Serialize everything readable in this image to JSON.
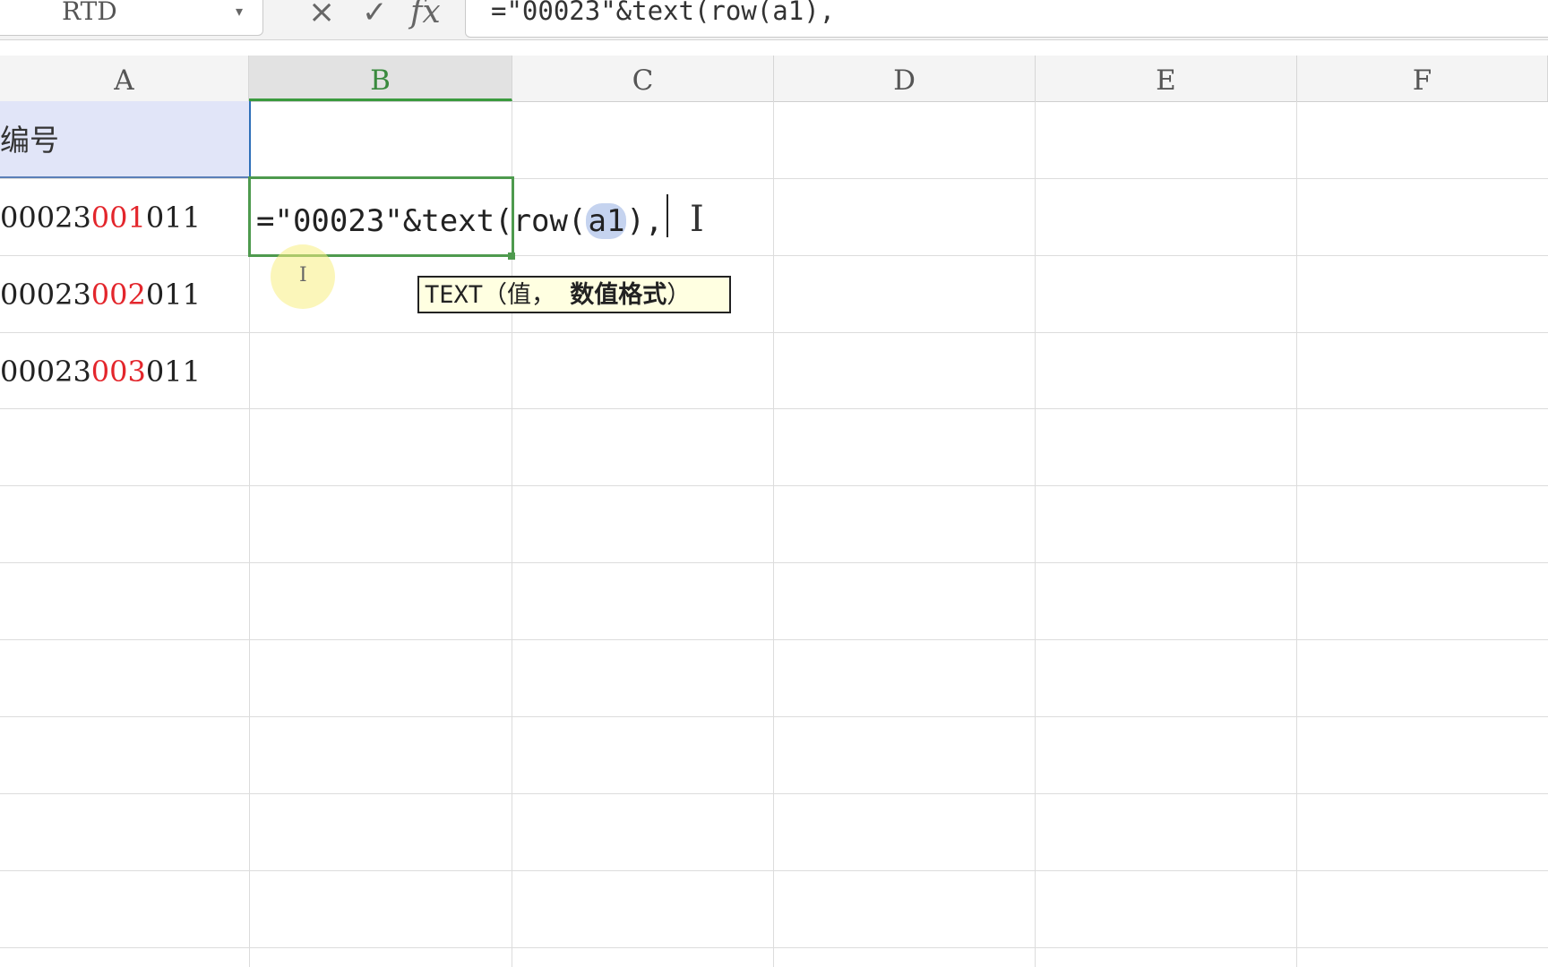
{
  "formula_bar": {
    "name_box_value": "RTD",
    "cancel_icon": "×",
    "confirm_icon": "✓",
    "fx_label": "fx",
    "formula": "=\"00023\"&text(row(a1),"
  },
  "columns": [
    {
      "label": "A",
      "selected": false
    },
    {
      "label": "B",
      "selected": true
    },
    {
      "label": "C",
      "selected": false
    },
    {
      "label": "D",
      "selected": false
    },
    {
      "label": "E",
      "selected": false
    },
    {
      "label": "F",
      "selected": false
    }
  ],
  "cells": {
    "a1": "编号",
    "a2": {
      "prefix": "00023",
      "highlight": "001",
      "suffix": "011"
    },
    "a3": {
      "prefix": "00023",
      "highlight": "002",
      "suffix": "011"
    },
    "a4": {
      "prefix": "00023",
      "highlight": "003",
      "suffix": "011"
    }
  },
  "editing": {
    "before": "=\"00023\"&text(row(",
    "highlighted_arg": "a1",
    "after": "),"
  },
  "tooltip": {
    "function": "TEXT",
    "open": "（",
    "arg1": "值，",
    "arg2": "数值格式",
    "close": "）"
  },
  "colors": {
    "accent_green": "#4e9a4e",
    "highlight_red": "#e3262c",
    "header_fill": "#e1e5f8"
  }
}
